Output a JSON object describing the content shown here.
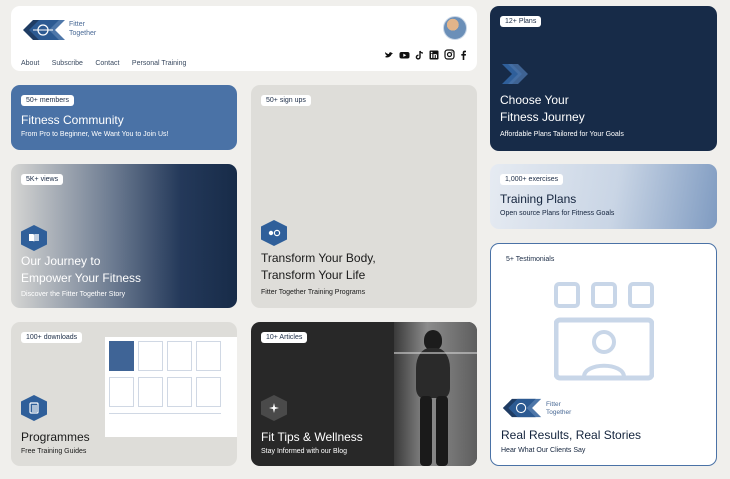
{
  "header": {
    "brand_line1": "Fitter",
    "brand_line2": "Together",
    "nav": [
      "About",
      "Subscribe",
      "Contact",
      "Personal Training"
    ],
    "social_icons": [
      "twitter-icon",
      "youtube-icon",
      "tiktok-icon",
      "linkedin-icon",
      "instagram-icon",
      "facebook-icon"
    ]
  },
  "cards": {
    "plans": {
      "badge": "12+ Plans",
      "title1": "Choose Your",
      "title2": "Fitness Journey",
      "sub": "Affordable Plans Tailored for Your Goals"
    },
    "community": {
      "badge": "50+ members",
      "title": "Fitness Community",
      "sub": "From Pro to Beginner, We Want You to Join Us!"
    },
    "signups": {
      "badge": "50+ sign ups",
      "title1": "Transform Your Body,",
      "title2": "Transform Your Life",
      "sub": "Fitter Together Training Programs"
    },
    "training": {
      "badge": "1,000+ exercises",
      "title": "Training Plans",
      "sub": "Open source Plans for Fitness Goals"
    },
    "journey": {
      "badge": "5K+ views",
      "title1": "Our Journey to",
      "title2": "Empower Your Fitness",
      "sub": "Discover the Fitter Together Story"
    },
    "testimonials": {
      "badge": "5+ Testimonials",
      "brand_line1": "Fitter",
      "brand_line2": "Together",
      "title": "Real Results, Real Stories",
      "sub": "Hear What Our Clients Say"
    },
    "programmes": {
      "badge": "100+ downloads",
      "title": "Programmes",
      "sub": "Free Training Guides"
    },
    "tips": {
      "badge": "10+ Articles",
      "title": "Fit Tips & Wellness",
      "sub": "Stay Informed with our Blog"
    }
  },
  "colors": {
    "navy": "#172b48",
    "blue": "#4a72a6",
    "grey": "#deddd9",
    "dark": "#282828",
    "accent": "#2f5f9a"
  }
}
